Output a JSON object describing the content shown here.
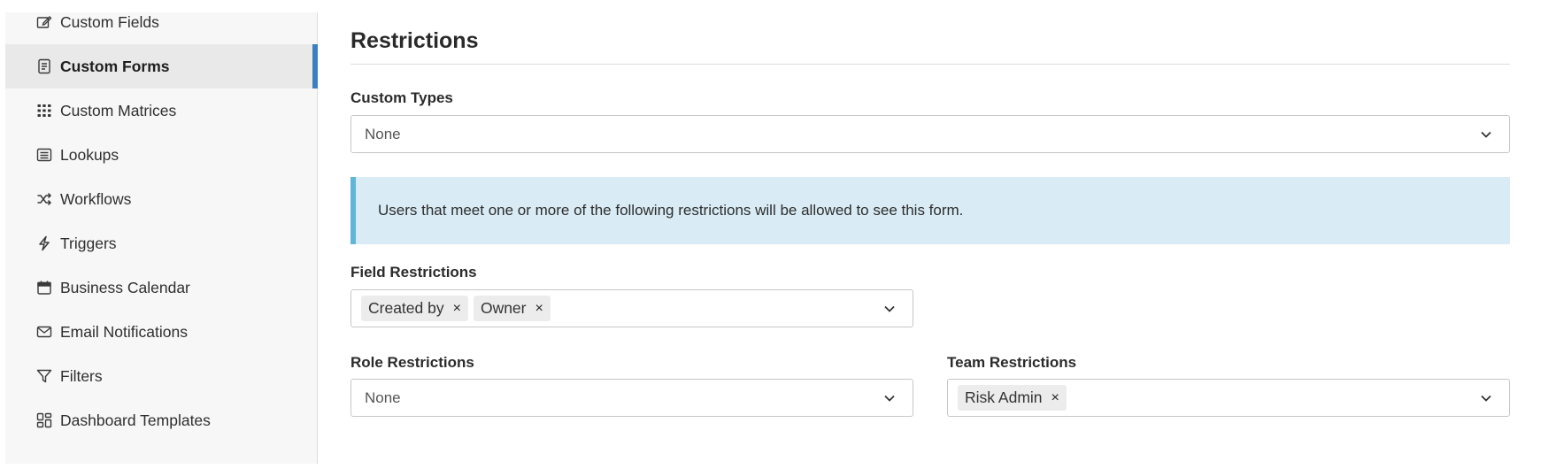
{
  "sidebar": {
    "items": [
      {
        "label": "Custom Fields",
        "icon": "edit-icon"
      },
      {
        "label": "Custom Forms",
        "icon": "form-icon",
        "active": true
      },
      {
        "label": "Custom Matrices",
        "icon": "grid-icon"
      },
      {
        "label": "Lookups",
        "icon": "list-box-icon"
      },
      {
        "label": "Workflows",
        "icon": "shuffle-icon"
      },
      {
        "label": "Triggers",
        "icon": "lightning-icon"
      },
      {
        "label": "Business Calendar",
        "icon": "calendar-icon"
      },
      {
        "label": "Email Notifications",
        "icon": "envelope-icon"
      },
      {
        "label": "Filters",
        "icon": "filter-icon"
      },
      {
        "label": "Dashboard Templates",
        "icon": "dashboard-icon"
      }
    ]
  },
  "main": {
    "title": "Restrictions",
    "custom_types": {
      "label": "Custom Types",
      "value": "None"
    },
    "info_text": "Users that meet one or more of the following restrictions will be allowed to see this form.",
    "field_restrictions": {
      "label": "Field Restrictions",
      "tags": [
        "Created by",
        "Owner"
      ]
    },
    "role_restrictions": {
      "label": "Role Restrictions",
      "value": "None"
    },
    "team_restrictions": {
      "label": "Team Restrictions",
      "tags": [
        "Risk Admin"
      ]
    },
    "remove_glyph": "×"
  },
  "colors": {
    "accent": "#3c7fc0",
    "info_bg": "#d9ecf5",
    "info_border": "#5fb6d9"
  }
}
